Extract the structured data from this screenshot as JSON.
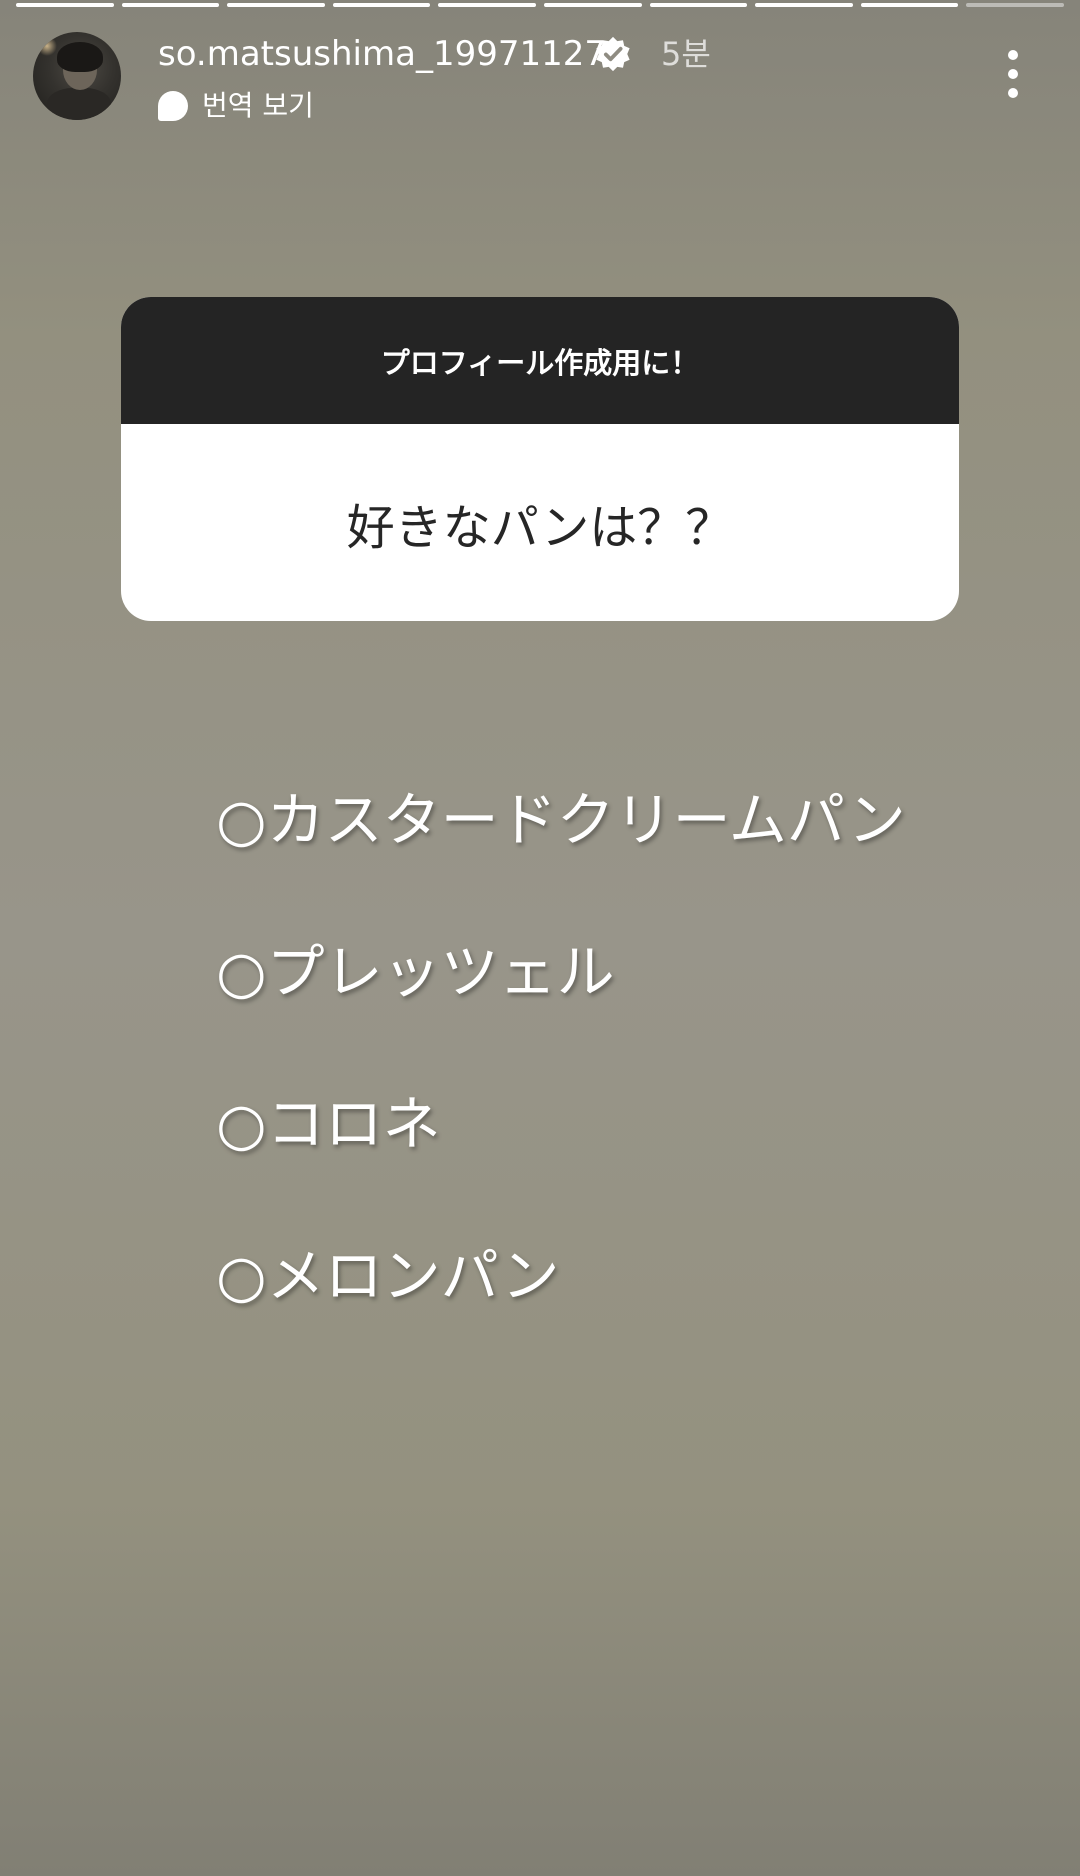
{
  "story": {
    "segment_count": 10,
    "current_segment": 10
  },
  "header": {
    "username": "so.matsushima_19971127",
    "verified_icon": "verified-badge-icon",
    "time_ago": "5분",
    "translate_icon": "speech-bubble-icon",
    "translate_label": "번역 보기",
    "more_icon": "more-vertical-icon"
  },
  "question": {
    "header": "プロフィール作成用に！",
    "text": "好きなパンは？？"
  },
  "options": [
    "○カスタードクリームパン",
    "○プレッツェル",
    "○コロネ",
    "○メロンパン"
  ],
  "colors": {
    "question_header_bg": "#242424",
    "text_white": "#ffffff"
  }
}
